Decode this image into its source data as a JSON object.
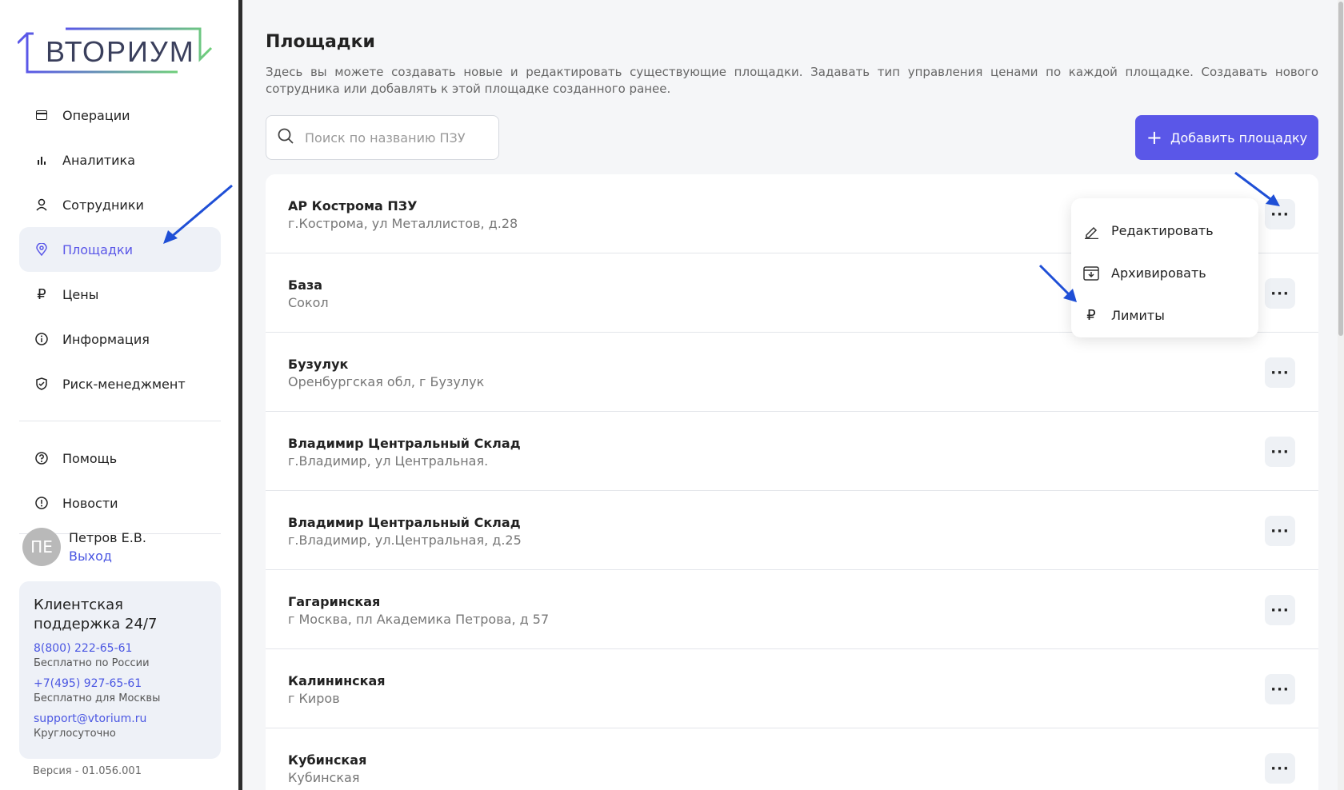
{
  "logo": {
    "text": "ВТОРИУМ"
  },
  "nav": {
    "items": [
      {
        "label": "Операции",
        "icon": "card-icon"
      },
      {
        "label": "Аналитика",
        "icon": "bar-chart-icon"
      },
      {
        "label": "Сотрудники",
        "icon": "user-icon"
      },
      {
        "label": "Площадки",
        "icon": "location-pin-icon",
        "active": true
      },
      {
        "label": "Цены",
        "icon": "ruble-icon"
      },
      {
        "label": "Информация",
        "icon": "info-icon"
      },
      {
        "label": "Риск-менеджмент",
        "icon": "shield-icon"
      }
    ],
    "secondary": [
      {
        "label": "Помощь",
        "icon": "help-icon"
      },
      {
        "label": "Новости",
        "icon": "alert-icon"
      }
    ]
  },
  "user": {
    "initials": "ПЕ",
    "name": "Петров Е.В.",
    "logout": "Выход"
  },
  "support": {
    "title": "Клиентская поддержка 24/7",
    "phone1": "8(800) 222-65-61",
    "phone1_note": "Бесплатно по России",
    "phone2": "+7(495) 927-65-61",
    "phone2_note": "Бесплатно для Москвы",
    "email": "support@vtorium.ru",
    "email_note": "Круглосуточно"
  },
  "version": "Версия - 01.056.001",
  "page": {
    "title": "Площадки",
    "description": "Здесь вы можете создавать новые и редактировать существующие площадки. Задавать тип управления ценами по каждой площадке. Создавать нового сотрудника или добавлять к этой площадке созданного ранее."
  },
  "search": {
    "placeholder": "Поиск по названию ПЗУ",
    "value": ""
  },
  "add_button": {
    "label": "Добавить площадку"
  },
  "sites": [
    {
      "name": "АР Кострома ПЗУ",
      "address": "г.Кострома, ул Металлистов, д.28"
    },
    {
      "name": "База",
      "address": "Сокол"
    },
    {
      "name": "Бузулук",
      "address": "Оренбургская обл, г Бузулук"
    },
    {
      "name": "Владимир Центральный Склад",
      "address": "г.Владимир, ул Центральная."
    },
    {
      "name": "Владимир Центральный Склад",
      "address": "г.Владимир, ул.Центральная, д.25"
    },
    {
      "name": "Гагаринская",
      "address": "г Москва, пл Академика Петрова, д 57"
    },
    {
      "name": "Калининская",
      "address": "г Киров"
    },
    {
      "name": "Кубинская",
      "address": "Кубинская"
    }
  ],
  "more_label": "···",
  "dropdown": {
    "items": [
      {
        "label": "Редактировать",
        "icon": "pencil-icon"
      },
      {
        "label": "Архивировать",
        "icon": "archive-icon"
      },
      {
        "label": "Лимиты",
        "icon": "ruble-icon"
      }
    ]
  },
  "colors": {
    "accent": "#5a57e8",
    "link": "#4a56e2",
    "arrow": "#1f4fd6"
  }
}
